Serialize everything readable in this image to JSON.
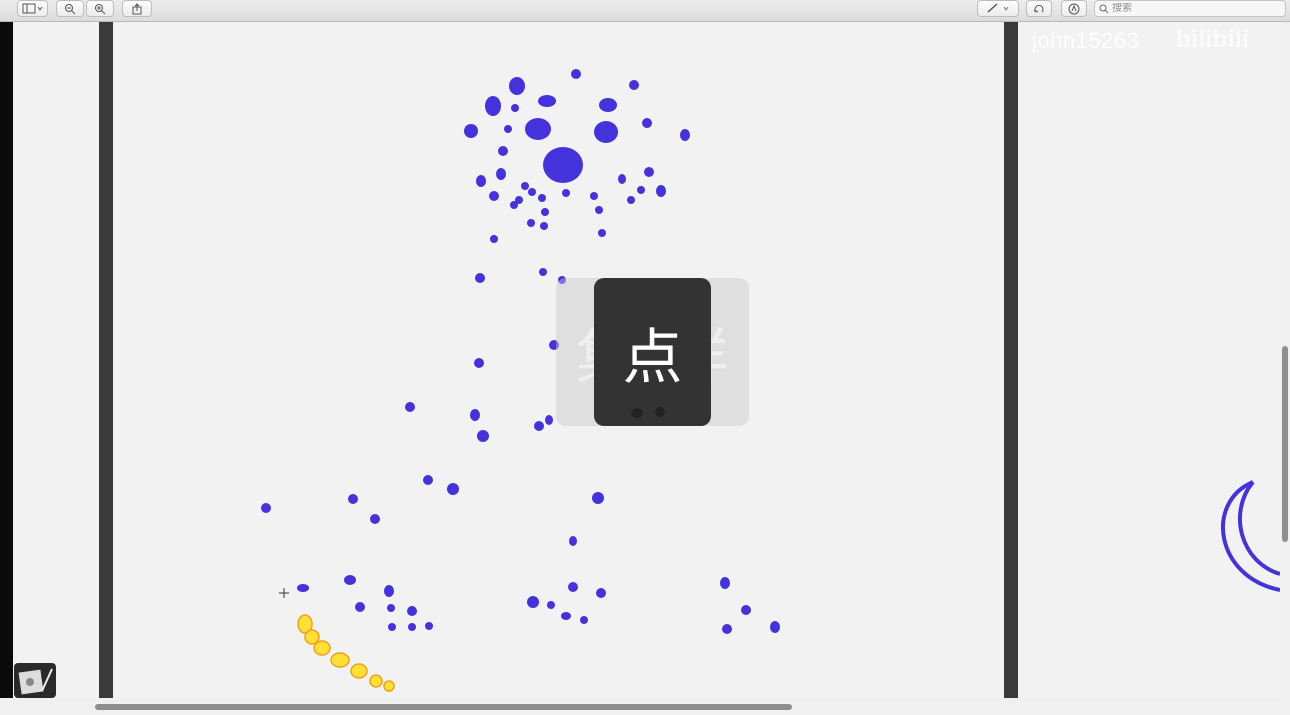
{
  "toolbar": {
    "search_placeholder": "搜索",
    "buttons": [
      "sidebar-toggle",
      "zoom-out",
      "zoom-in",
      "share",
      "markup-pen",
      "rotate",
      "annotate"
    ]
  },
  "overlay": {
    "key_label": "点",
    "ghost_left": "集",
    "ghost_right": "详"
  },
  "watermark": {
    "user": "john15263",
    "brand": "bilibili"
  },
  "colors": {
    "dot_blue": "#4433dd",
    "highlight_yellow": "#ffe033",
    "border_dark": "#3a3a3a"
  }
}
